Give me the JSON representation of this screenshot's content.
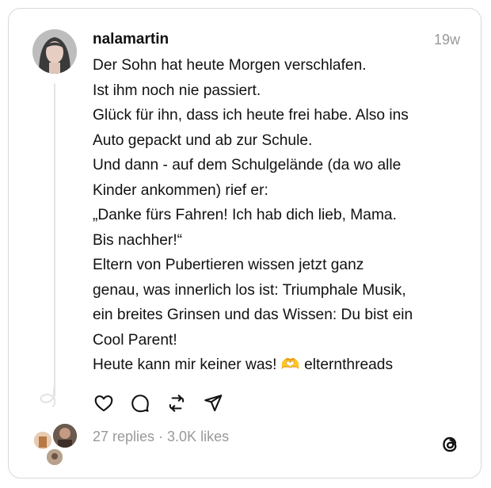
{
  "post": {
    "username": "nalamartin",
    "timestamp": "19w",
    "lines": [
      "Der Sohn hat heute Morgen verschlafen.",
      "Ist ihm noch nie passiert.",
      "Glück für ihn, dass ich heute frei habe. Also ins",
      "Auto gepackt und ab zur Schule.",
      "Und dann - auf dem Schulgelände (da wo alle",
      "Kinder ankommen) rief er:",
      "„Danke fürs Fahren! Ich hab dich lieb, Mama.",
      "Bis nachher!“",
      "Eltern von Pubertieren wissen jetzt ganz",
      "genau, was innerlich los ist: Triumphale Musik,",
      "ein breites Grinsen und das Wissen: Du bist ein",
      "Cool Parent!"
    ],
    "last_line_text": "Heute kann mir keiner was!",
    "last_line_emoji": "🫶",
    "tag": "elternthreads"
  },
  "actions": [
    "heart-icon",
    "comment-icon",
    "repost-icon",
    "share-icon"
  ],
  "stats": {
    "summary": "27 replies · 3.0K likes"
  },
  "colors": {
    "muted": "#999999",
    "border": "#d9d9d9",
    "text": "#111111"
  }
}
